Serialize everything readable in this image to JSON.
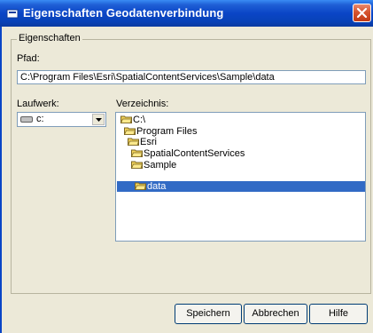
{
  "window": {
    "title": "Eigenschaften Geodatenverbindung"
  },
  "group": {
    "legend": "Eigenschaften"
  },
  "path": {
    "label": "Pfad:",
    "value": "C:\\Program Files\\Esri\\SpatialContentServices\\Sample\\data"
  },
  "drive": {
    "label": "Laufwerk:",
    "value": "c:"
  },
  "directory": {
    "label": "Verzeichnis:",
    "items": [
      {
        "label": "C:\\",
        "selected": false
      },
      {
        "label": "Program Files",
        "selected": false
      },
      {
        "label": "Esri",
        "selected": false
      },
      {
        "label": "SpatialContentServices",
        "selected": false
      },
      {
        "label": "Sample",
        "selected": false
      },
      {
        "label": "data",
        "selected": true
      }
    ]
  },
  "buttons": {
    "save": "Speichern",
    "cancel": "Abbrechen",
    "help": "Hilfe"
  },
  "colors": {
    "title_bar": "#0a45c6",
    "selection": "#316ac5",
    "dialog_bg": "#ece9d8",
    "close_button": "#d6542e"
  }
}
